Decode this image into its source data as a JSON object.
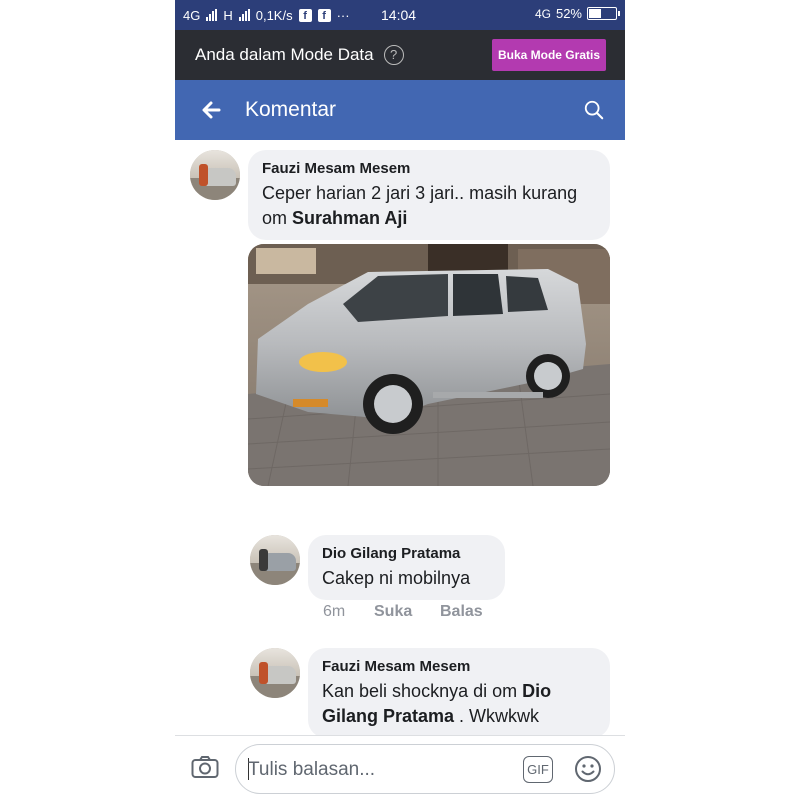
{
  "status_bar": {
    "network1": "4G",
    "network2": "H",
    "speed": "0,1K/s",
    "more": "···",
    "time": "14:04",
    "network_right": "4G",
    "battery": "52%",
    "battery_level": 0.52
  },
  "data_mode": {
    "label": "Anda dalam Mode Data",
    "help": "?",
    "button": "Buka Mode Gratis"
  },
  "header": {
    "title": "Komentar"
  },
  "comments": [
    {
      "author": "Fauzi Mesam Mesem",
      "text_before": "Ceper harian 2 jari 3 jari.. masih kurang om ",
      "mention": "Surahman Aji",
      "text_after": ""
    },
    {
      "author": "Dio Gilang Pratama",
      "text_before": "Cakep ni mobilnya",
      "mention": "",
      "text_after": "",
      "time": "6m",
      "like": "Suka",
      "reply": "Balas"
    },
    {
      "author": "Fauzi Mesam Mesem",
      "text_before": "Kan beli shocknya di om ",
      "mention": "Dio Gilang Pratama",
      "text_after": " . Wkwkwk"
    }
  ],
  "composer": {
    "placeholder": "Tulis balasan...",
    "gif": "GIF"
  },
  "colors": {
    "status_bar": "#2c3e79",
    "data_bar": "#2b2d33",
    "header": "#4267b2",
    "free_button": "#b33ab0",
    "bubble": "#f0f1f4"
  },
  "icons": [
    "back-arrow-icon",
    "search-icon",
    "camera-icon",
    "gif-icon",
    "smiley-icon",
    "help-icon",
    "facebook-icon"
  ]
}
